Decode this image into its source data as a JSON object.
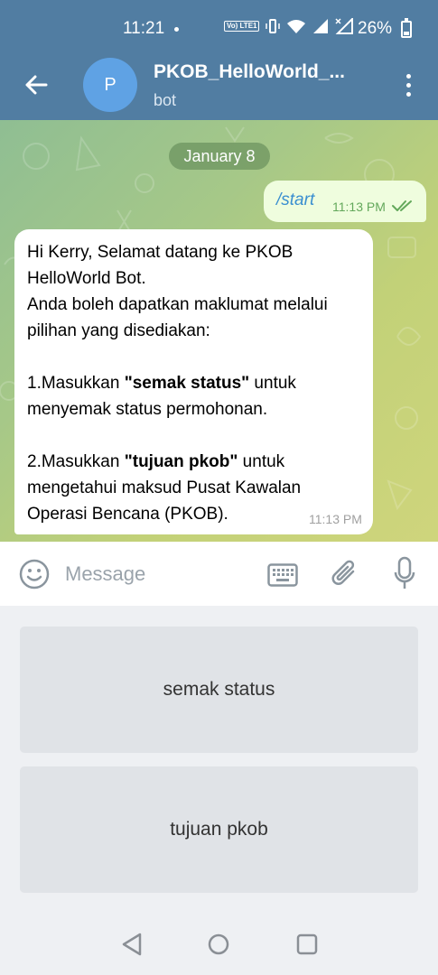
{
  "status_bar": {
    "time": "11:21",
    "volte_label": "Vo) LTE1",
    "battery_percent": "26%"
  },
  "header": {
    "avatar_letter": "P",
    "title": "PKOB_HelloWorld_...",
    "subtitle": "bot"
  },
  "chat": {
    "date_chip": "January 8",
    "outgoing": {
      "text": "/start",
      "time": "11:13 PM",
      "read": true
    },
    "incoming": {
      "lines": [
        "Hi Kerry, Selamat datang ke PKOB",
        "HelloWorld Bot.",
        "Anda boleh dapatkan maklumat melalui",
        "pilihan yang disediakan:"
      ],
      "item1_prefix": "1.Masukkan ",
      "item1_bold": "\"semak status\"",
      "item1_suffix": " untuk",
      "item1_line2": "menyemak status permohonan.",
      "item2_prefix": "2.Masukkan ",
      "item2_bold": "\"tujuan pkob\"",
      "item2_suffix": " untuk",
      "item2_line2": "mengetahui maksud Pusat Kawalan",
      "item2_line3": "Operasi Bencana (PKOB).",
      "time": "11:13 PM"
    }
  },
  "input": {
    "placeholder": "Message"
  },
  "bot_keyboard": {
    "buttons": [
      "semak status",
      "tujuan pkob"
    ]
  },
  "icons": {
    "back": "arrow-left-icon",
    "menu": "more-vertical-icon",
    "emoji": "smiley-icon",
    "keyboard": "keyboard-icon",
    "attach": "paperclip-icon",
    "mic": "microphone-icon"
  },
  "colors": {
    "header": "#517da2",
    "outgoing_bubble": "#effdde",
    "incoming_bubble": "#ffffff",
    "link_text": "#3a8fd0",
    "keyboard_button": "#e0e3e7"
  }
}
